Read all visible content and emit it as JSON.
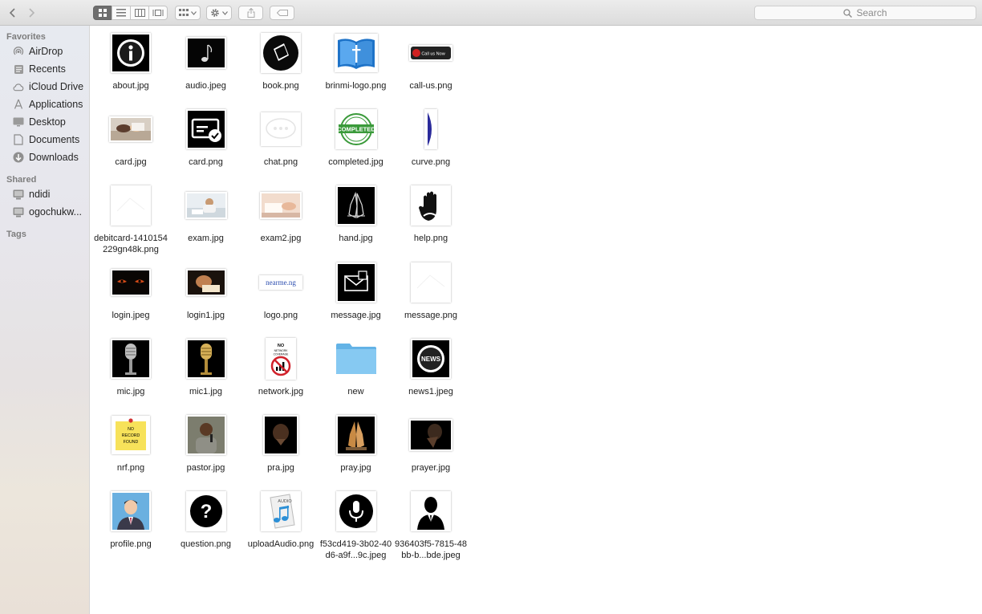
{
  "search": {
    "placeholder": "Search"
  },
  "sidebar": {
    "favorites_heading": "Favorites",
    "favorites": [
      {
        "label": "AirDrop",
        "icon": "airdrop-icon"
      },
      {
        "label": "Recents",
        "icon": "recents-icon"
      },
      {
        "label": "iCloud Drive",
        "icon": "cloud-icon"
      },
      {
        "label": "Applications",
        "icon": "applications-icon"
      },
      {
        "label": "Desktop",
        "icon": "desktop-icon"
      },
      {
        "label": "Documents",
        "icon": "documents-icon"
      },
      {
        "label": "Downloads",
        "icon": "downloads-icon"
      }
    ],
    "shared_heading": "Shared",
    "shared": [
      {
        "label": "ndidi",
        "icon": "computer-icon"
      },
      {
        "label": "ogochukw...",
        "icon": "computer-icon"
      }
    ],
    "tags_heading": "Tags"
  },
  "files": [
    {
      "name": "about.jpg",
      "kind": "info"
    },
    {
      "name": "audio.jpeg",
      "kind": "note"
    },
    {
      "name": "book.png",
      "kind": "book"
    },
    {
      "name": "brinmi-logo.png",
      "kind": "bible"
    },
    {
      "name": "call-us.png",
      "kind": "callus",
      "text": "Call us Now"
    },
    {
      "name": "card.jpg",
      "kind": "photo-hands"
    },
    {
      "name": "card.png",
      "kind": "cardcheck"
    },
    {
      "name": "chat.png",
      "kind": "chat"
    },
    {
      "name": "completed.jpg",
      "kind": "stamp",
      "text": "COMPLETED"
    },
    {
      "name": "curve.png",
      "kind": "curve"
    },
    {
      "name": "debitcard-1410154229gn48k.png",
      "kind": "blank"
    },
    {
      "name": "exam.jpg",
      "kind": "photo-exam"
    },
    {
      "name": "exam2.jpg",
      "kind": "photo-exam2"
    },
    {
      "name": "hand.jpg",
      "kind": "pray-dark"
    },
    {
      "name": "help.png",
      "kind": "hand"
    },
    {
      "name": "login.jpeg",
      "kind": "eyes"
    },
    {
      "name": "login1.jpg",
      "kind": "photo-login"
    },
    {
      "name": "logo.png",
      "kind": "logo",
      "text": "nearme.ng"
    },
    {
      "name": "message.jpg",
      "kind": "envelope"
    },
    {
      "name": "message.png",
      "kind": "blank"
    },
    {
      "name": "mic.jpg",
      "kind": "mic-silver"
    },
    {
      "name": "mic1.jpg",
      "kind": "mic-gold"
    },
    {
      "name": "network.jpg",
      "kind": "nonetwork",
      "text": "NO NETWORK COVERAGE"
    },
    {
      "name": "new",
      "kind": "folder"
    },
    {
      "name": "news1.jpeg",
      "kind": "news",
      "text": "NEWS"
    },
    {
      "name": "nrf.png",
      "kind": "sticky",
      "text": "NO RECORD FOUND"
    },
    {
      "name": "pastor.jpg",
      "kind": "photo-pastor"
    },
    {
      "name": "pra.jpg",
      "kind": "photo-pra"
    },
    {
      "name": "pray.jpg",
      "kind": "pray-gold"
    },
    {
      "name": "prayer.jpg",
      "kind": "photo-prayer"
    },
    {
      "name": "profile.png",
      "kind": "profile"
    },
    {
      "name": "question.png",
      "kind": "question"
    },
    {
      "name": "uploadAudio.png",
      "kind": "audiofile",
      "text": "AUDIO"
    },
    {
      "name": "f53cd419-3b02-40d6-a9f...9c.jpeg",
      "kind": "mic-circle"
    },
    {
      "name": "936403f5-7815-48bb-b...bde.jpeg",
      "kind": "person"
    }
  ]
}
